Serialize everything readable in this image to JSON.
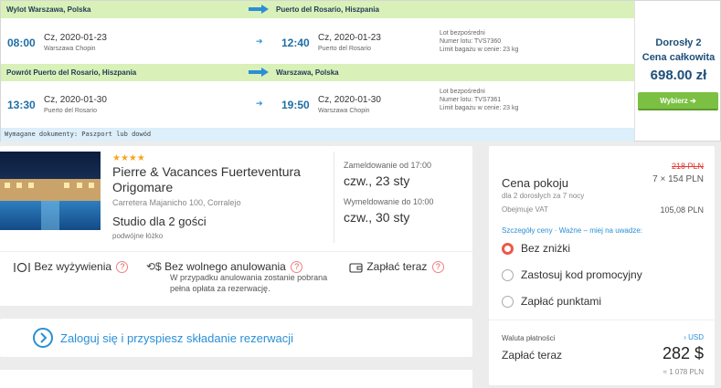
{
  "flight": {
    "out_header_from": "Wylot  Warszawa, Polska",
    "out_header_to": "Puerto del Rosario, Hiszpania",
    "out_dep_time": "08:00",
    "out_dep_date": "Cz, 2020-01-23",
    "out_dep_airport": "Warszawa Chopin",
    "out_arr_time": "12:40",
    "out_arr_date": "Cz, 2020-01-23",
    "out_arr_airport": "Puerto del Rosario",
    "out_info_1": "Lot bezpośredni",
    "out_info_2": "Numer lotu: TVS7360",
    "out_info_3": "Limit bagażu w cenie: 23 kg",
    "ret_header_from": "Powrót  Puerto del Rosario, Hiszpania",
    "ret_header_to": "Warszawa, Polska",
    "ret_dep_time": "13:30",
    "ret_dep_date": "Cz, 2020-01-30",
    "ret_dep_airport": "Puerto del Rosario",
    "ret_arr_time": "19:50",
    "ret_arr_date": "Cz, 2020-01-30",
    "ret_arr_airport": "Warszawa Chopin",
    "ret_info_1": "Lot bezpośredni",
    "ret_info_2": "Numer lotu: TVS7361",
    "ret_info_3": "Limit bagażu w cenie: 23 kg",
    "documents": "Wymagane dokumenty: Paszport lub dowód",
    "price_label_1": "Dorosły 2",
    "price_label_2": "Cena całkowita",
    "price": "698.00 zł",
    "select_label": "Wybierz  ➔",
    "colors": {
      "header_bg": "#d9f0b8",
      "arrow": "#2c8ed6",
      "time": "#1e6ea5",
      "button": "#7bc043"
    }
  },
  "hotel": {
    "stars": "★★★★",
    "name": "Pierre & Vacances Fuerteventura Origomare",
    "address": "Carretera Majanicho 100, Corralejo",
    "room": "Studio dla 2 gości",
    "bed": "podwójne łóżko",
    "checkin_label": "Zameldowanie od 17:00",
    "checkin_value": "czw., 23 sty",
    "checkout_label": "Wymeldowanie do 10:00",
    "checkout_value": "czw., 30 sty",
    "feature_meals": "Bez wyżywienia",
    "feature_cancel": "Bez wolnego anulowania",
    "feature_cancel_sub": "W przypadku anulowania zostanie pobrana pełna opłata za rezerwację.",
    "feature_pay": "Zapłać teraz",
    "help_mark": "?"
  },
  "login": {
    "label": "Zaloguj się i przyspiesz składanie rezerwacji"
  },
  "pricebox": {
    "old_price": "218 PLN",
    "room_label": "Cena pokoju",
    "room_calc": "7 × 154 PLN",
    "room_sub": "dla 2 dorosłych  za 7 nocy",
    "vat_label": "Obejmuje VAT",
    "vat_value": "105,08 PLN",
    "links": "Szczegóły ceny  ·  Ważne – miej na uwadze:",
    "opt_1": "Bez zniżki",
    "opt_2": "Zastosuj kod promocyjny",
    "opt_3": "Zapłać punktami",
    "currency_label": "Waluta płatności",
    "currency_value": "› USD",
    "pay_label": "Zapłać teraz",
    "pay_value": "282 $",
    "pay_pln": "≈ 1 078 PLN"
  }
}
